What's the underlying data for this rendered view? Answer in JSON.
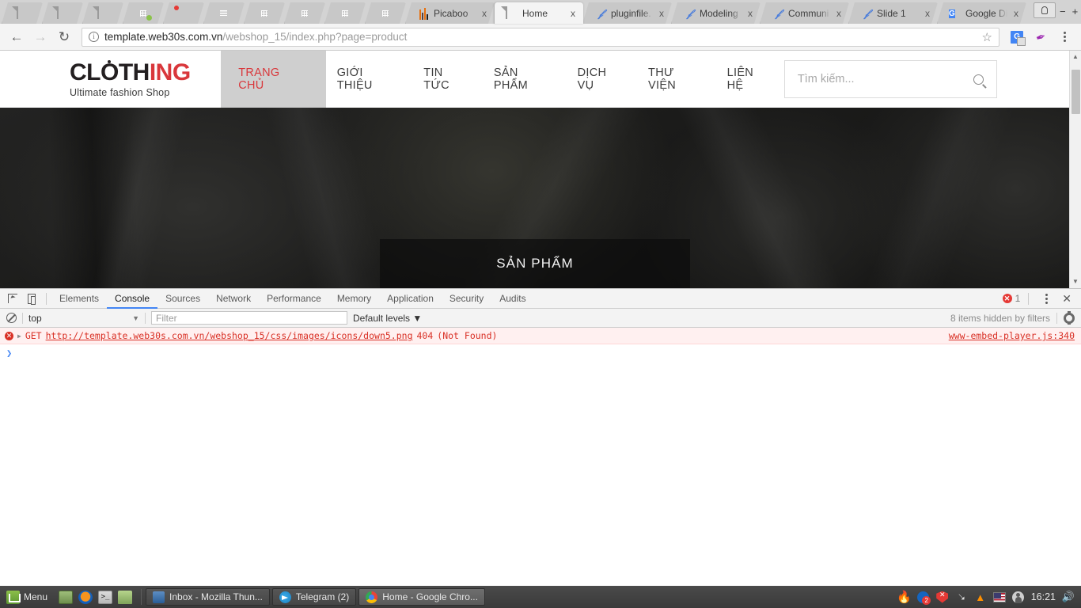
{
  "browser": {
    "tabs": [
      {
        "title": "",
        "favicon": "doc-icon",
        "type": "small"
      },
      {
        "title": "",
        "favicon": "doc-icon",
        "type": "small"
      },
      {
        "title": "",
        "favicon": "doc-icon",
        "type": "small"
      },
      {
        "title": "",
        "favicon": "google-sheets-icon",
        "type": "small"
      },
      {
        "title": "",
        "favicon": "thunderbird-icon",
        "type": "small"
      },
      {
        "title": "",
        "favicon": "google-docs-icon",
        "type": "small"
      },
      {
        "title": "",
        "favicon": "google-sheets-icon",
        "type": "small"
      },
      {
        "title": "",
        "favicon": "google-sheets-icon",
        "type": "small"
      },
      {
        "title": "",
        "favicon": "google-sheets-icon",
        "type": "small"
      },
      {
        "title": "",
        "favicon": "google-sheets-icon",
        "type": "small"
      },
      {
        "title": "Picaboo",
        "favicon": "picaboo-icon",
        "type": "wide"
      },
      {
        "title": "Home",
        "favicon": "doc-icon",
        "type": "wide",
        "active": true
      },
      {
        "title": "pluginfile.",
        "favicon": "moodle-icon",
        "type": "wide"
      },
      {
        "title": "Modeling",
        "favicon": "moodle-icon",
        "type": "wide"
      },
      {
        "title": "Communi",
        "favicon": "moodle-icon",
        "type": "wide"
      },
      {
        "title": "Slide 1",
        "favicon": "moodle-icon",
        "type": "wide"
      },
      {
        "title": "Google Di",
        "favicon": "google-drive-icon",
        "type": "wide"
      }
    ],
    "tab_close_label": "x",
    "window_controls": {
      "minimize": "−",
      "maximize": "+",
      "close": "✕"
    },
    "toolbar": {
      "back": "←",
      "forward": "→",
      "reload": "↻",
      "info_icon": "i",
      "url_host": "template.web30s.com.vn",
      "url_path": "/webshop_15/index.php?page=product",
      "bookmark_star": "☆",
      "extension_translate": "G",
      "extension_feather": "✒",
      "menu": "kebab-menu"
    }
  },
  "site": {
    "logo": {
      "part1": "CL",
      "part_o": "O",
      "part2": "TH",
      "part_red": "ING",
      "tagline": "Ultimate fashion Shop"
    },
    "nav": [
      {
        "label": "TRANG CHỦ",
        "active": true
      },
      {
        "label": "GIỚI THIỆU",
        "active": false
      },
      {
        "label": "TIN TỨC",
        "active": false
      },
      {
        "label": "SẢN PHẨM",
        "active": false
      },
      {
        "label": "DỊCH VỤ",
        "active": false
      },
      {
        "label": "THƯ VIỆN",
        "active": false
      },
      {
        "label": "LIÊN HỆ",
        "active": false
      }
    ],
    "search": {
      "placeholder": "Tìm kiếm...",
      "value": "",
      "icon": "search-icon"
    },
    "hero": {
      "title": "SẢN PHẨM"
    }
  },
  "devtools": {
    "tabs": [
      "Elements",
      "Console",
      "Sources",
      "Network",
      "Performance",
      "Memory",
      "Application",
      "Security",
      "Audits"
    ],
    "active_tab": "Console",
    "error_count": "1",
    "close_label": "✕",
    "filterbar": {
      "clear_icon": "clear-console-icon",
      "context": "top",
      "context_arrow": "▼",
      "filter_placeholder": "Filter",
      "filter_value": "",
      "levels": "Default levels ▼",
      "hidden_items": "8 items hidden by filters",
      "settings_icon": "gear-icon"
    },
    "messages": [
      {
        "method": "GET",
        "url": "http://template.web30s.com.vn/webshop_15/css/images/icons/down5.png",
        "status": "404",
        "status_text": "(Not Found)",
        "source": "www-embed-player.js:340",
        "expand": "▶"
      }
    ],
    "prompt": "❯"
  },
  "taskbar": {
    "menu_label": "Menu",
    "quicklaunch": [
      "show-desktop-icon",
      "firefox-icon",
      "terminal-icon",
      "files-icon"
    ],
    "windows": [
      {
        "title": "Inbox - Mozilla Thun...",
        "icon": "thunderbird-icon",
        "active": false
      },
      {
        "title": "Telegram (2)",
        "icon": "telegram-icon",
        "active": false
      },
      {
        "title": "Home - Google Chro...",
        "icon": "chrome-icon",
        "active": true
      }
    ],
    "tray": {
      "notification_count": "2",
      "clock": "16:21",
      "volume_icon": "volume-icon",
      "flag_icon": "us-flag-icon",
      "user_icon": "user-icon"
    }
  }
}
